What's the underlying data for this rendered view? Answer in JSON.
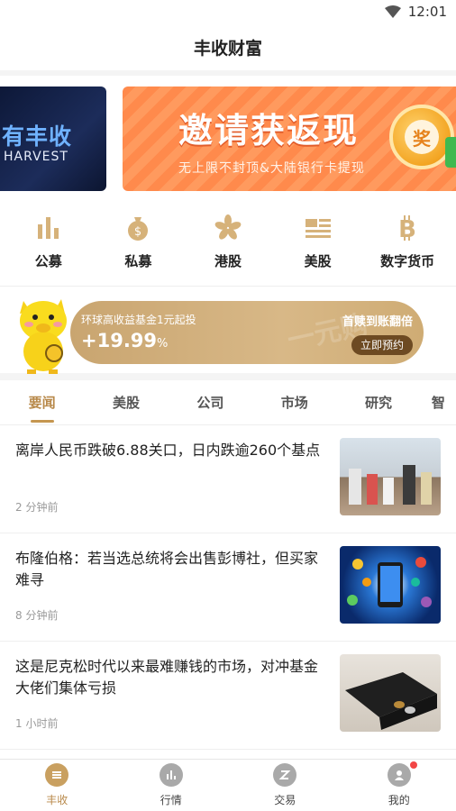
{
  "status_bar": {
    "time": "12:01"
  },
  "header": {
    "title": "丰收财富"
  },
  "banner": {
    "left_text_cn": "有丰收",
    "left_text_en": "HARVEST",
    "right_title": "邀请获返现",
    "right_subtitle": "无上限不封顶&大陆银行卡提现",
    "coin_label": "奖"
  },
  "categories": [
    {
      "label": "公募",
      "icon": "bar-chart-icon"
    },
    {
      "label": "私募",
      "icon": "money-bag-icon"
    },
    {
      "label": "港股",
      "icon": "bauhinia-flower-icon"
    },
    {
      "label": "美股",
      "icon": "us-flag-icon"
    },
    {
      "label": "数字货币",
      "icon": "bitcoin-icon"
    }
  ],
  "promo": {
    "description": "环球高收益基金1元起投",
    "rate": "+19.99",
    "rate_unit": "%",
    "headline": "首赎到账翻倍",
    "button": "立即预约",
    "watermark": "一元购"
  },
  "tabs": [
    "要闻",
    "美股",
    "公司",
    "市场",
    "研究",
    "智"
  ],
  "news": [
    {
      "title": "离岸人民币跌破6.88关口，日内跌逾260个基点",
      "time": "2 分钟前"
    },
    {
      "title": "布隆伯格：若当选总统将会出售彭博社，但买家难寻",
      "time": "8 分钟前"
    },
    {
      "title": "这是尼克松时代以来最难赚钱的市场，对冲基金大佬们集体亏损",
      "time": "1 小时前"
    }
  ],
  "bottom_nav": [
    {
      "label": "丰收",
      "icon": "harvest-coin-icon"
    },
    {
      "label": "行情",
      "icon": "market-chart-icon"
    },
    {
      "label": "交易",
      "icon": "trade-icon"
    },
    {
      "label": "我的",
      "icon": "profile-icon"
    }
  ],
  "colors": {
    "accent": "#c5964f",
    "banner_orange": "#ff8a4c",
    "promo_gold": "#d8b887",
    "notification_red": "#f24646"
  }
}
